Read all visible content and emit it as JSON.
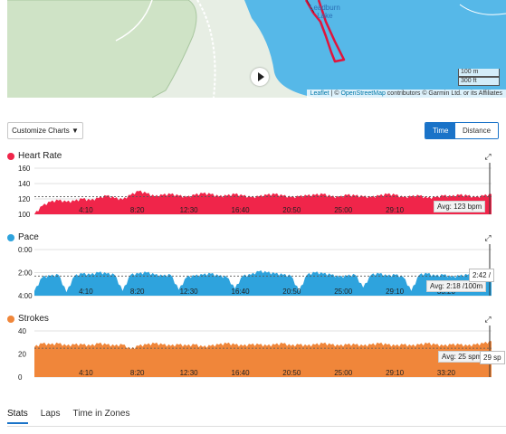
{
  "map": {
    "lake_label_1": "Leadburn",
    "lake_label_2": "Lake",
    "scale_m": "100 m",
    "scale_ft": "300 ft",
    "attribution": {
      "leaflet": "Leaflet",
      "sep": " | © ",
      "osm": "OpenStreetMap",
      "rest": " contributors © Garmin Ltd. or its Affiliates"
    },
    "colors": {
      "water": "#56b8e8",
      "park": "#cfe3c6",
      "land": "#e7eee4",
      "route": "#e0143c"
    }
  },
  "toolbar": {
    "customize_label": "Customize Charts ▼",
    "toggle_time": "Time",
    "toggle_distance": "Distance"
  },
  "charts": {
    "heart_rate": {
      "title": "Heart Rate",
      "avg_label": "Avg: 123 bpm",
      "color": "#f0254a",
      "expand_icon": "expand-icon"
    },
    "pace": {
      "title": "Pace",
      "avg_label": "Avg: 2:18 /100m",
      "tooltip": "2:42 /",
      "color": "#2ea3dd",
      "expand_icon": "expand-icon"
    },
    "strokes": {
      "title": "Strokes",
      "avg_label": "Avg: 25 spm",
      "tooltip": "29 sp",
      "color": "#f0863a",
      "expand_icon": "expand-icon"
    }
  },
  "chart_data": [
    {
      "type": "area",
      "title": "Heart Rate",
      "y_ticks": [
        "160",
        "140",
        "120",
        "100"
      ],
      "ylim": [
        100,
        160
      ],
      "x_ticks": [
        "4:10",
        "8:20",
        "12:30",
        "16:40",
        "20:50",
        "25:00",
        "29:10",
        "33:20"
      ],
      "x_tick_minutes": [
        4.17,
        8.33,
        12.5,
        16.67,
        20.83,
        25.0,
        29.17,
        33.33
      ],
      "xlim": [
        0,
        37
      ],
      "average": 123,
      "series": [
        {
          "values": [
            100,
            111,
            116,
            118,
            116,
            117,
            120,
            118,
            121,
            124,
            121,
            119,
            125,
            130,
            127,
            123,
            125,
            126,
            124,
            122,
            125,
            127,
            126,
            123,
            124,
            126,
            124,
            122,
            123,
            125,
            126,
            124,
            122,
            123,
            124,
            125,
            126,
            123,
            122,
            125,
            124,
            123,
            122,
            124,
            126,
            125,
            122,
            123,
            124,
            121,
            122,
            124,
            123,
            125,
            124,
            122,
            124,
            126
          ]
        }
      ]
    },
    {
      "type": "area",
      "title": "Pace",
      "y_ticks": [
        "0:00",
        "2:00",
        "4:00"
      ],
      "ylim": [
        0,
        4
      ],
      "y_inverted": true,
      "x_ticks": [
        "4:10",
        "8:20",
        "12:30",
        "16:40",
        "20:50",
        "25:00",
        "29:10",
        "33:20"
      ],
      "x_tick_minutes": [
        4.17,
        8.33,
        12.5,
        16.67,
        20.83,
        25.0,
        29.17,
        33.33
      ],
      "xlim": [
        0,
        37
      ],
      "average": "2:18",
      "series": [
        {
          "values": [
            3.6,
            2.4,
            2.3,
            2.2,
            3.7,
            2.3,
            2.1,
            2.2,
            2.0,
            2.1,
            2.2,
            3.6,
            2.2,
            2.1,
            2.0,
            2.2,
            2.3,
            2.2,
            3.5,
            2.4,
            2.3,
            2.2,
            2.1,
            2.3,
            2.4,
            3.4,
            2.3,
            2.2,
            1.9,
            2.0,
            2.1,
            2.2,
            2.3,
            3.6,
            2.2,
            2.0,
            2.1,
            2.2,
            2.4,
            2.3,
            2.2,
            3.3,
            2.2,
            2.1,
            2.3,
            2.2,
            2.4,
            3.6,
            2.2,
            2.1,
            2.3,
            2.2,
            2.4,
            2.3,
            2.2,
            2.3,
            2.2,
            2.2
          ]
        }
      ]
    },
    {
      "type": "area",
      "title": "Strokes",
      "y_ticks": [
        "40",
        "20",
        "0"
      ],
      "ylim": [
        0,
        40
      ],
      "x_ticks": [
        "4:10",
        "8:20",
        "12:30",
        "16:40",
        "20:50",
        "25:00",
        "29:10",
        "33:20"
      ],
      "x_tick_minutes": [
        4.17,
        8.33,
        12.5,
        16.67,
        20.83,
        25.0,
        29.17,
        33.33
      ],
      "xlim": [
        0,
        37
      ],
      "average": 25,
      "series": [
        {
          "values": [
            26,
            29,
            28,
            29,
            27,
            28,
            28,
            27,
            29,
            28,
            27,
            28,
            24,
            27,
            28,
            29,
            28,
            27,
            28,
            27,
            28,
            26,
            27,
            28,
            29,
            28,
            27,
            28,
            28,
            27,
            28,
            29,
            27,
            28,
            27,
            28,
            29,
            28,
            27,
            28,
            28,
            27,
            28,
            29,
            28,
            27,
            28,
            27,
            28,
            29,
            28,
            27,
            28,
            28,
            27,
            28,
            29,
            31
          ]
        }
      ]
    }
  ],
  "tabs": [
    "Stats",
    "Laps",
    "Time in Zones"
  ]
}
